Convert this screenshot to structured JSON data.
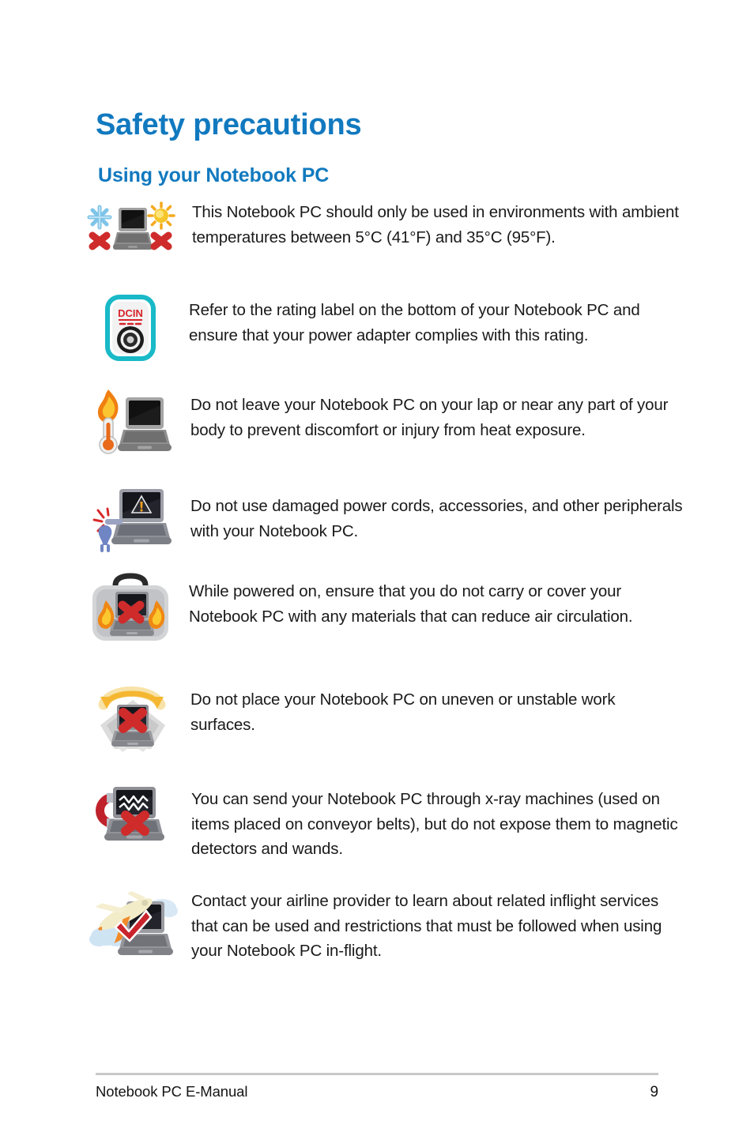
{
  "document": {
    "title": "Safety precautions",
    "section_title": "Using your Notebook PC"
  },
  "theme": {
    "heading_color": "#1179bf",
    "body_color": "#1a1a1a",
    "rule_color": "#c9c9c9",
    "warn_red": "#c8232c",
    "flame_orange": "#f5a623",
    "magnet_red": "#c0222b",
    "teal": "#17b6c4",
    "laptop_gray": "#9b9b9b"
  },
  "notes": [
    {
      "icon": "temperature-range-icon",
      "icon_parts": [
        "snowflake-icon",
        "red-x-icon",
        "laptop-icon",
        "sun-icon",
        "red-x-icon"
      ],
      "text": "This Notebook PC should only be used in environments with ambient temperatures between 5°C (41°F) and 35°C (95°F)."
    },
    {
      "icon": "dc-in-rating-label-icon",
      "icon_label": "DCIN",
      "icon_parts": [
        "power-jack-icon"
      ],
      "text": "Refer to the rating label on the bottom of your Notebook PC and ensure that your power adapter complies with this rating."
    },
    {
      "icon": "heat-exposure-icon",
      "icon_parts": [
        "thermometer-icon",
        "flame-icon",
        "laptop-icon"
      ],
      "text": "Do not leave your Notebook PC on your lap or near any part of your body to prevent discomfort or injury from heat exposure."
    },
    {
      "icon": "damaged-power-cord-icon",
      "icon_parts": [
        "laptop-icon",
        "warning-triangle-icon",
        "plug-icon",
        "spark-icon"
      ],
      "text": "Do not use damaged power cords, accessories, and other peripherals with your Notebook PC."
    },
    {
      "icon": "do-not-cover-icon",
      "icon_parts": [
        "carrying-bag-icon",
        "laptop-icon",
        "red-x-icon",
        "flame-icon"
      ],
      "text": "While powered on, ensure that you do not carry or cover your Notebook PC with any materials that can reduce air circulation."
    },
    {
      "icon": "uneven-surface-icon",
      "icon_parts": [
        "rocking-arrow-icon",
        "laptop-icon",
        "red-x-icon"
      ],
      "text": "Do not place your Notebook PC on uneven or unstable work surfaces."
    },
    {
      "icon": "magnetic-detector-icon",
      "icon_parts": [
        "magnet-icon",
        "laptop-icon",
        "red-x-icon",
        "interference-icon"
      ],
      "text": "You can send your Notebook PC through x-ray machines (used on items placed on conveyor belts), but do not expose them to magnetic detectors and wands."
    },
    {
      "icon": "inflight-use-icon",
      "icon_parts": [
        "airplane-icon",
        "cloud-icon",
        "laptop-icon",
        "red-check-icon"
      ],
      "text": "Contact your airline provider to learn about related inflight services that can be used and restrictions that must be followed when using your Notebook PC in-flight."
    }
  ],
  "footer": {
    "left": "Notebook PC E-Manual",
    "page_number": "9"
  }
}
